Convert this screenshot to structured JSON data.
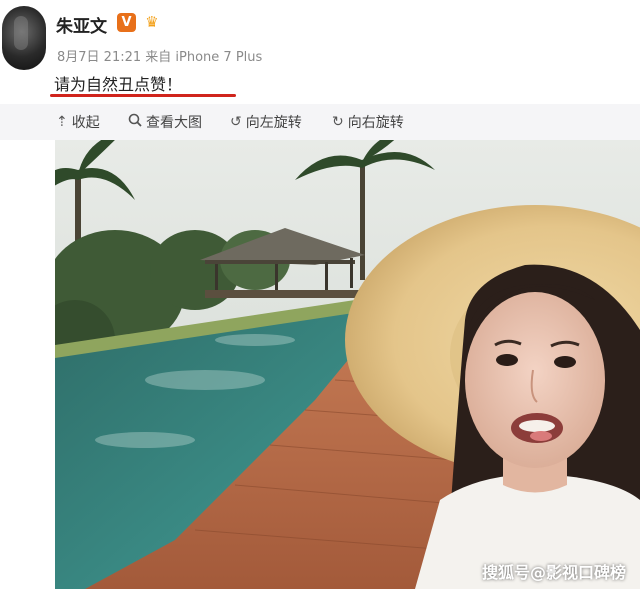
{
  "post": {
    "username": "朱亚文",
    "verified_badge": "V",
    "crown_icon": "crown-icon",
    "meta": "8月7日 21:21 来自 iPhone 7 Plus",
    "text": "请为自然丑点赞！"
  },
  "toolbar": {
    "collapse_label": "收起",
    "view_large_label": "查看大图",
    "rotate_left_label": "向左旋转",
    "rotate_right_label": "向右旋转"
  },
  "photo": {
    "watermark": "搜狐号@影视口碑榜"
  },
  "colors": {
    "accent_red": "#d0241c",
    "badge_orange": "#e8701a"
  }
}
